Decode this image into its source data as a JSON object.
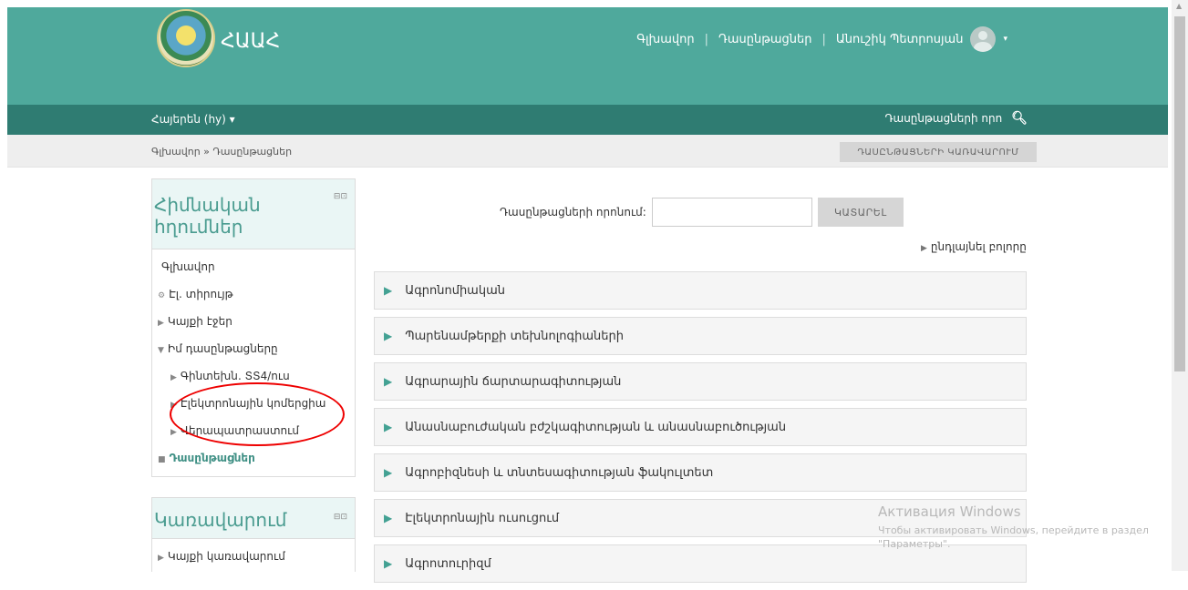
{
  "header": {
    "brand": "ՀԱԱՀ",
    "nav": [
      "Գլխավոր",
      "Դասընթացներ",
      "Անուշիկ Պետրոսյան"
    ],
    "separator": "|",
    "caret": "▾"
  },
  "langbar": {
    "language": "Հայերեն (hy) ▾",
    "search_label": "Դասընթացների որո",
    "search_icon": "search-icon"
  },
  "breadcrumb": {
    "path": "Գլխավոր » Դասընթացներ",
    "manage_button": "ԴԱՍԸՆԹԱՑՆԵՐԻ ԿԱՌԱՎԱՐՈՒՄ"
  },
  "nav_block": {
    "title": "Հիմնական հղումներ",
    "controls": "⊟⊡",
    "items": [
      {
        "marker": "",
        "label": "Գլխավոր"
      },
      {
        "marker": "⚙",
        "label": "Էլ. տիրույթ"
      },
      {
        "marker": "▶",
        "label": "Կայքի էջեր"
      },
      {
        "marker": "▼",
        "label": "Իմ դասընթացները"
      },
      {
        "marker": "▶",
        "label": "Գինտեխն․ ՏՏ4/ուս"
      },
      {
        "marker": "▶",
        "label": "Էլեկտրոնային կոմերցիա"
      },
      {
        "marker": "▶",
        "label": "Վերապատրաստում"
      },
      {
        "marker": "■",
        "label": "Դասընթացներ"
      }
    ]
  },
  "admin_block": {
    "title": "Կառավարում",
    "controls": "⊟⊡",
    "items": [
      {
        "marker": "▶",
        "label": "Կայքի կառավարում"
      }
    ]
  },
  "course_search": {
    "label": "Դասընթացների որոնում:",
    "value": "",
    "button": "ԿԱՏԱՐԵԼ"
  },
  "expand_all": "ընդլայնել բոլորը",
  "categories": [
    "Ագրոնոմիական",
    "Պարենամթերքի տեխնոլոգիաների",
    "Ագրարային ճարտարագիտության",
    "Անասնաբուժական բժշկագիտության և անասնաբուծության",
    "Ագրոբիզնեսի և տնտեսագիտության ֆակուլտետ",
    "Էլեկտրոնային ուսուցում",
    "Ագրոտուրիզմ"
  ],
  "watermark": {
    "title": "Активация Windows",
    "text": "Чтобы активировать Windows, перейдите в раздел \"Параметры\"."
  },
  "colors": {
    "header": "#4fa99c",
    "langbar": "#2f7c72",
    "accent": "#3e8f84",
    "annotation": "#e00000"
  }
}
